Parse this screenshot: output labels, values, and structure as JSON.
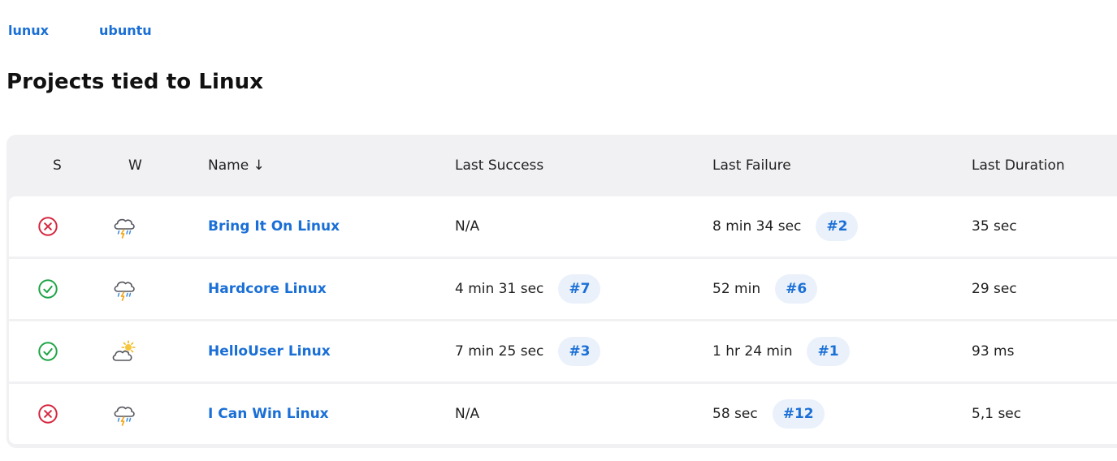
{
  "labels": [
    "lunux",
    "ubuntu"
  ],
  "page_title": "Projects tied to Linux",
  "columns": {
    "status": "S",
    "weather": "W",
    "name": "Name ↓",
    "last_success": "Last Success",
    "last_failure": "Last Failure",
    "last_duration": "Last Duration"
  },
  "colors": {
    "failed": "#d6253d",
    "success": "#1ea446",
    "link": "#1a6fd6"
  },
  "jobs": [
    {
      "status": "failed",
      "status_icon": "failed-status-icon",
      "weather_icon": "thunderstorm-icon",
      "name": "Bring It On Linux",
      "last_success": "N/A",
      "last_success_build": "",
      "last_failure": "8 min 34 sec",
      "last_failure_build": "#2",
      "last_duration": "35 sec"
    },
    {
      "status": "success",
      "status_icon": "success-status-icon",
      "weather_icon": "thunderstorm-icon",
      "name": "Hardcore Linux",
      "last_success": "4 min 31 sec",
      "last_success_build": "#7",
      "last_failure": "52 min",
      "last_failure_build": "#6",
      "last_duration": "29 sec"
    },
    {
      "status": "success",
      "status_icon": "success-status-icon",
      "weather_icon": "partly-cloudy-icon",
      "name": "HelloUser Linux",
      "last_success": "7 min 25 sec",
      "last_success_build": "#3",
      "last_failure": "1 hr 24 min",
      "last_failure_build": "#1",
      "last_duration": "93 ms"
    },
    {
      "status": "failed",
      "status_icon": "failed-status-icon",
      "weather_icon": "thunderstorm-icon",
      "name": "I Can Win Linux",
      "last_success": "N/A",
      "last_success_build": "",
      "last_failure": "58 sec",
      "last_failure_build": "#12",
      "last_duration": "5,1 sec"
    }
  ]
}
